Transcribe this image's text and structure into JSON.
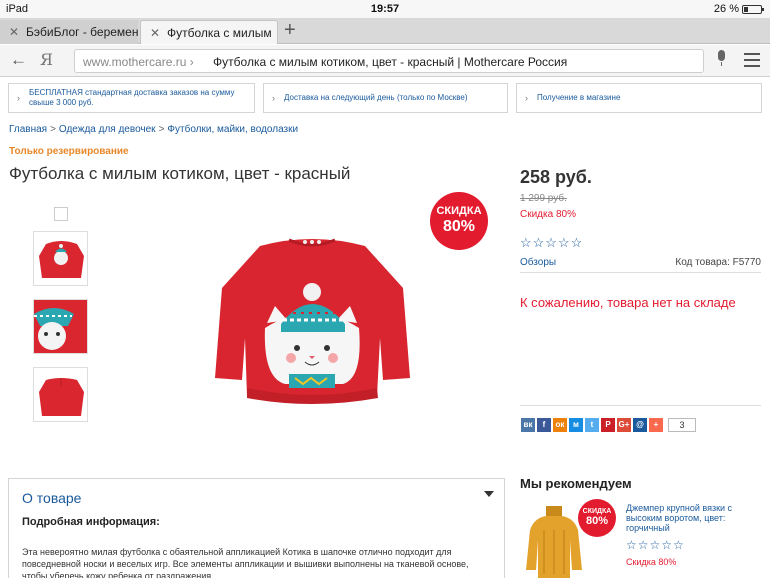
{
  "status_bar": {
    "device": "iPad",
    "time": "19:57",
    "battery": "26 %",
    "battery_level": 0.26
  },
  "tabs": [
    {
      "label": "БэбиБлог - беременно"
    },
    {
      "label": "Футболка с милым"
    }
  ],
  "address_bar": {
    "domain": "www.mothercare.ru ›",
    "page_title": "Футболка с милым котиком, цвет - красный | Mothercare Россия"
  },
  "icons": {
    "back": "arrow-left-icon",
    "yandex": "yandex-logo-icon",
    "mic": "microphone-icon",
    "menu": "hamburger-menu-icon",
    "close_tab": "close-icon",
    "new_tab": "plus-icon",
    "info": "chevron-right-icon",
    "collapse": "caret-down-icon"
  },
  "delivery": [
    "БЕСПЛАТНАЯ стандартная доставка заказов на сумму свыше 3 000 руб.",
    "Доставка на следующий день (только по Москве)",
    "Получение в магазине"
  ],
  "breadcrumb": [
    "Главная",
    "Одежда для девочек",
    "Футболки, майки, водолазки"
  ],
  "breadcrumb_sep": ">",
  "product": {
    "reserve_label": "Только резервирование",
    "title": "Футболка с милым котиком, цвет - красный",
    "badge_top": "СКИДКА",
    "badge_value": "80%",
    "price": "258 руб.",
    "old_price": "1 299 руб.",
    "discount": "Скидка 80%",
    "stars": "☆☆☆☆☆",
    "reviews_link": "Обзоры",
    "code": "Код товара: F5770",
    "stock_message": "К сожалению, товара нет на складе",
    "rating": 0
  },
  "share": {
    "buttons": [
      {
        "label": "вк",
        "color": "#4a76a8",
        "name": "vk-icon"
      },
      {
        "label": "f",
        "color": "#3b5998",
        "name": "facebook-icon"
      },
      {
        "label": "ок",
        "color": "#ee8208",
        "name": "odnoklassniki-icon"
      },
      {
        "label": "м",
        "color": "#168de2",
        "name": "mailru-icon"
      },
      {
        "label": "t",
        "color": "#55acee",
        "name": "twitter-icon"
      },
      {
        "label": "P",
        "color": "#cb2027",
        "name": "pinterest-icon"
      },
      {
        "label": "G+",
        "color": "#dd4b39",
        "name": "google-plus-icon"
      },
      {
        "label": "@",
        "color": "#1a5a9c",
        "name": "email-icon"
      },
      {
        "label": "+",
        "color": "#f8694d",
        "name": "more-share-icon"
      }
    ],
    "count": "3"
  },
  "about": {
    "title": "О товаре",
    "subtitle": "Подробная информация:",
    "text": "Эта невероятно милая футболка с обаятельной аппликацией Котика в шапочке отлично подходит для повседневной носки и веселых игр. Все элементы аппликации и вышивки выполнены на тканевой основе, чтобы уберечь кожу ребенка от раздражения."
  },
  "recommend": {
    "title": "Мы рекомендуем",
    "badge_top": "СКИДКА",
    "badge_value": "80%",
    "name": "Джемпер крупной вязки с высоким воротом, цвет: горчичный",
    "stars": "☆☆☆☆☆",
    "discount": "Скидка 80%"
  },
  "colors": {
    "accent": "#e31b2f",
    "link": "#1a5a9c",
    "orange": "#e8872a"
  }
}
